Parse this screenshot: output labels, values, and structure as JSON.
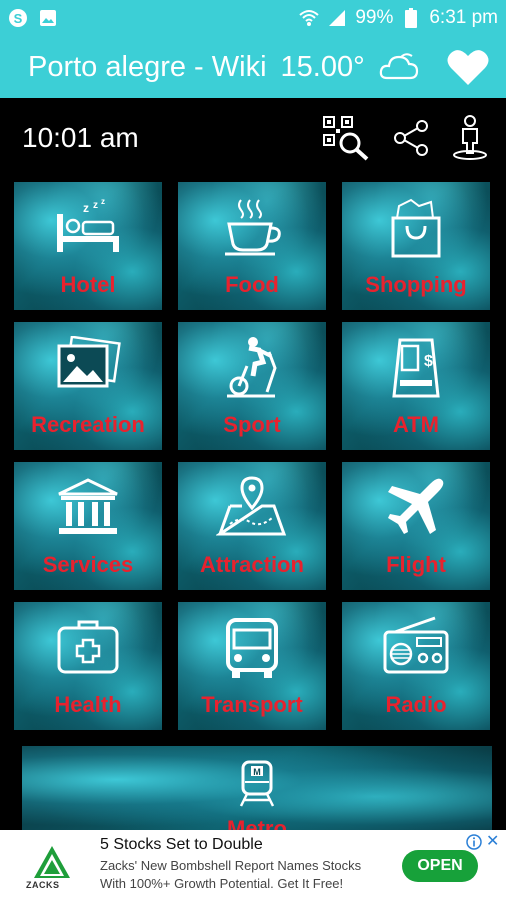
{
  "status_bar": {
    "battery": "99%",
    "time": "6:31 pm",
    "icons": [
      "skype-icon",
      "gallery-icon",
      "wifi-icon",
      "signal-icon",
      "battery-icon"
    ]
  },
  "app_bar": {
    "title": "Porto alegre - Wiki",
    "temperature": "15.00°",
    "weather_icon": "cloud-icon",
    "favorite_icon": "heart-icon",
    "background_color": "#3ccfd6"
  },
  "toolbar": {
    "clock": "10:01 am",
    "tools": [
      "qr-search-icon",
      "share-icon",
      "person-location-icon"
    ]
  },
  "categories": [
    {
      "label": "Hotel",
      "icon": "hotel-bed-icon"
    },
    {
      "label": "Food",
      "icon": "coffee-cup-icon"
    },
    {
      "label": "Shopping",
      "icon": "shopping-bag-icon"
    },
    {
      "label": "Recreation",
      "icon": "picture-icon"
    },
    {
      "label": "Sport",
      "icon": "exercise-bike-icon"
    },
    {
      "label": "ATM",
      "icon": "atm-machine-icon"
    },
    {
      "label": "Services",
      "icon": "bank-building-icon"
    },
    {
      "label": "Attraction",
      "icon": "map-pin-icon"
    },
    {
      "label": "Flight",
      "icon": "airplane-icon"
    },
    {
      "label": "Health",
      "icon": "first-aid-kit-icon"
    },
    {
      "label": "Transport",
      "icon": "bus-icon"
    },
    {
      "label": "Radio",
      "icon": "radio-icon"
    }
  ],
  "metro": {
    "label": "Metro",
    "icon": "metro-train-icon"
  },
  "label_color": "#e8222e",
  "ad": {
    "title": "5 Stocks Set to Double",
    "body": "Zacks' New Bombshell Report Names Stocks With 100%+ Growth Potential. Get It Free!",
    "button": "OPEN",
    "logo_text": "ZACKS",
    "close": "✕",
    "button_color": "#17a13a"
  }
}
